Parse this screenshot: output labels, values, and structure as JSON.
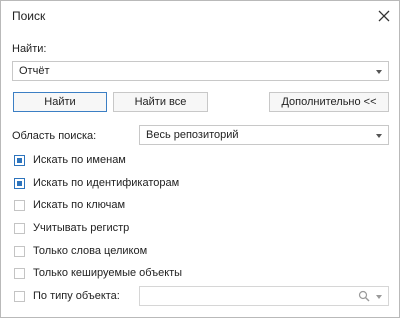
{
  "dialog": {
    "title": "Поиск"
  },
  "find": {
    "label": "Найти:",
    "value": "Отчёт"
  },
  "buttons": {
    "find": "Найти",
    "find_all": "Найти все",
    "more": "Дополнительно <<"
  },
  "scope": {
    "label": "Область поиска:",
    "value": "Весь репозиторий"
  },
  "options": [
    {
      "label": "Искать по именам",
      "checked": true
    },
    {
      "label": "Искать по идентификаторам",
      "checked": true
    },
    {
      "label": "Искать по ключам",
      "checked": false
    },
    {
      "label": "Учитывать регистр",
      "checked": false
    },
    {
      "label": "Только слова целиком",
      "checked": false
    },
    {
      "label": "Только кешируемые объекты",
      "checked": false
    },
    {
      "label": "По типу объекта:",
      "checked": false
    }
  ],
  "object_type": {
    "value": ""
  },
  "colors": {
    "accent": "#2d74bd",
    "border": "#c8c8c8"
  }
}
